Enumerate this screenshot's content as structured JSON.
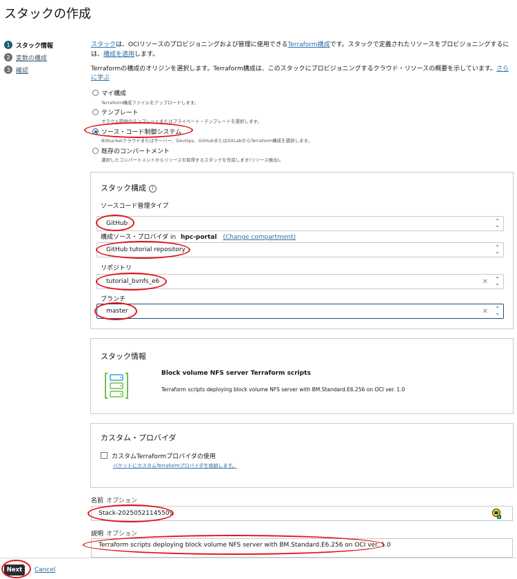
{
  "page": {
    "title": "スタックの作成"
  },
  "steps": [
    {
      "num": "1",
      "label": "スタック情報"
    },
    {
      "num": "2",
      "label": "変数の構成"
    },
    {
      "num": "3",
      "label": "確認"
    }
  ],
  "intro": {
    "link1": "スタック",
    "text1": "は、OCIリソースのプロビジョニングおよび管理に使用できる",
    "link2": "Terraform構成",
    "text2": "です。スタックで定義されたリソースをプロビジョニングするには、",
    "link3": "構成を適用",
    "text3": "します。"
  },
  "origin": {
    "text": "Terraformの構成のオリジンを選択します。Terraform構成は、このスタックにプロビジョニングするクラウド・リソースの概要を示しています。",
    "learn_more": "さらに学ぶ"
  },
  "radios": [
    {
      "label": "マイ構成",
      "desc": "Terraform構成ファイルをアップロードします。"
    },
    {
      "label": "テンプレート",
      "desc": "オラクル提供のテンプレートまたはプライベート・テンプレートを選択します。"
    },
    {
      "label": "ソース・コード制御システム",
      "desc": "Bitbucketクラウドまたはサーバー、DevOps、GitHubまたはGitLabからTerraform構成を選択します。"
    },
    {
      "label": "既存のコンパートメント",
      "desc": "選択したコンパートメントからリソースを取得するスタックを作成します(リソース検出)。"
    }
  ],
  "stack_config": {
    "title": "スタック構成",
    "info_icon": "i",
    "source_type_label": "ソースコード管理タイプ",
    "source_type_value": "GitHub",
    "provider_label": "構成ソース・プロバイダ in",
    "provider_compartment": "hpc-portal",
    "change_compartment": "(Change compartment)",
    "provider_value": "GitHub tutorial repository",
    "repository_label": "リポジトリ",
    "repository_value": "tutorial_bvnfs_e6",
    "branch_label": "ブランチ",
    "branch_value": "master"
  },
  "stack_info": {
    "title": "スタック情報",
    "name": "Block volume NFS server Terraform scripts",
    "description": "Terraform scripts deploying block volume NFS server with BM.Standard.E6.256 on OCI ver. 1.0",
    "icon": "server-stack-icon",
    "icon_colors": {
      "green": "#6cc04a",
      "blue": "#3aa0d8"
    }
  },
  "custom_provider": {
    "title": "カスタム・プロバイダ",
    "checkbox_label": "カスタムTerraformプロバイダの使用",
    "link": "バケットにカスタムTerraformプロバイダを格納します。"
  },
  "name_field": {
    "label": "名前",
    "optional": "オプション",
    "value": "Stack-20250521145509"
  },
  "description_field": {
    "label": "説明",
    "optional": "オプション",
    "value": "Terraform scripts deploying block volume NFS server with BM.Standard.E6.256 on OCI ver. 1.0"
  },
  "footer": {
    "next": "Next",
    "cancel": "Cancel"
  },
  "colors": {
    "annotation": "#e0151b",
    "link": "#2a6fa8",
    "primary": "#1b5a7a"
  }
}
